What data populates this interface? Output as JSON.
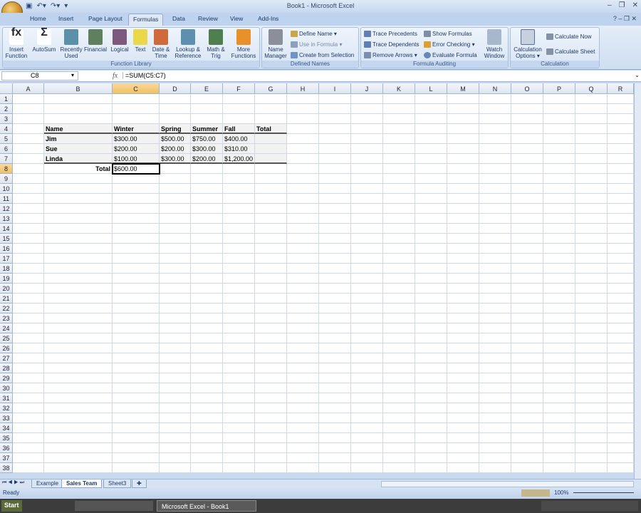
{
  "window": {
    "title": "Book1 - Microsoft Excel"
  },
  "tabs": [
    "Home",
    "Insert",
    "Page Layout",
    "Formulas",
    "Data",
    "Review",
    "View",
    "Add-Ins"
  ],
  "active_tab": "Formulas",
  "ribbon": {
    "function_library": {
      "label": "Function Library",
      "buttons": [
        "Insert Function",
        "AutoSum",
        "Recently Used",
        "Financial",
        "Logical",
        "Text",
        "Date & Time",
        "Lookup & Reference",
        "Math & Trig",
        "More Functions"
      ]
    },
    "defined_names": {
      "label": "Defined Names",
      "name_manager": "Name Manager",
      "define_name": "Define Name",
      "use_in_formula": "Use in Formula",
      "create_from_selection": "Create from Selection"
    },
    "formula_auditing": {
      "label": "Formula Auditing",
      "trace_precedents": "Trace Precedents",
      "trace_dependents": "Trace Dependents",
      "remove_arrows": "Remove Arrows",
      "show_formulas": "Show Formulas",
      "error_checking": "Error Checking",
      "evaluate_formula": "Evaluate Formula",
      "watch_window": "Watch Window"
    },
    "calculation": {
      "label": "Calculation",
      "options": "Calculation Options",
      "calculate_now": "Calculate Now",
      "calculate_sheet": "Calculate Sheet"
    }
  },
  "formula_bar": {
    "name_box": "C8",
    "fx": "fx",
    "formula": "=SUM(C5:C7)"
  },
  "columns": [
    "A",
    "B",
    "C",
    "D",
    "E",
    "F",
    "G",
    "H",
    "I",
    "J",
    "K",
    "L",
    "M",
    "N",
    "O",
    "P",
    "Q",
    "R"
  ],
  "selected_cell": "C8",
  "cells": {
    "B4": "Name",
    "C4": "Winter",
    "D4": "Spring",
    "E4": "Summer",
    "F4": "Fall",
    "G4": "Total",
    "B5": "Jim",
    "C5": "$300.00",
    "D5": "$500.00",
    "E5": "$750.00",
    "F5": "$400.00",
    "B6": "Sue",
    "C6": "$200.00",
    "D6": "$200.00",
    "E6": "$300.00",
    "F6": "$310.00",
    "B7": "Linda",
    "C7": "$100.00",
    "D7": "$300.00",
    "E7": "$200.00",
    "F7": "$1,200.00",
    "B8": "Total",
    "C8": "$600.00"
  },
  "sheets": [
    "Example",
    "Sales Team",
    "Sheet3"
  ],
  "active_sheet": "Sales Team",
  "status": {
    "text": "Ready",
    "zoom": "100%"
  },
  "taskbar": {
    "start": "Start",
    "active_task": "Microsoft Excel - Book1"
  }
}
